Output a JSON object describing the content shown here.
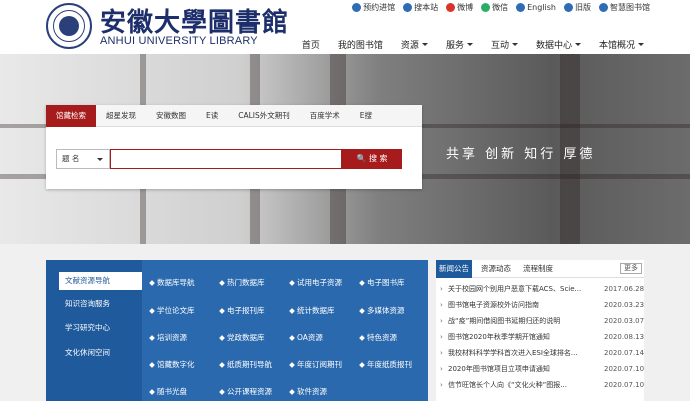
{
  "header": {
    "title_cn": "安徽大學圖書館",
    "title_en": "ANHUI UNIVERSITY LIBRARY",
    "quicklinks": [
      {
        "label": "预约进馆",
        "icon": "clock-icon",
        "color": "#2f6cb3"
      },
      {
        "label": "搜本站",
        "icon": "search-icon",
        "color": "#2f6cb3"
      },
      {
        "label": "微博",
        "icon": "weibo-icon",
        "color": "#d9342b"
      },
      {
        "label": "微信",
        "icon": "wechat-icon",
        "color": "#2aae67"
      },
      {
        "label": "English",
        "icon": "english-icon",
        "color": "#2f6cb3"
      },
      {
        "label": "旧版",
        "icon": "old-version-icon",
        "color": "#2f6cb3"
      },
      {
        "label": "智慧图书馆",
        "icon": "smart-library-icon",
        "color": "#2f6cb3"
      }
    ],
    "nav": [
      {
        "label": "首页",
        "dropdown": false
      },
      {
        "label": "我的图书馆",
        "dropdown": false
      },
      {
        "label": "资源",
        "dropdown": true
      },
      {
        "label": "服务",
        "dropdown": true
      },
      {
        "label": "互动",
        "dropdown": true
      },
      {
        "label": "数据中心",
        "dropdown": true
      },
      {
        "label": "本馆概况",
        "dropdown": true
      }
    ]
  },
  "banner": {
    "slogan": "共享 创新 知行 厚德"
  },
  "search": {
    "tabs": [
      "馆藏检索",
      "超星发现",
      "安徽数图",
      "E读",
      "CALIS外文期刊",
      "百度学术",
      "E搜"
    ],
    "active_tab": 0,
    "field_select": "题 名",
    "query": "",
    "button": "搜 索"
  },
  "services": {
    "items": [
      "文献资源导航",
      "知识咨询服务",
      "学习研究中心",
      "文化休闲空间"
    ],
    "active": 0
  },
  "resources": [
    [
      "数据库导航",
      "热门数据库",
      "试用电子资源",
      "电子图书库"
    ],
    [
      "学位论文库",
      "电子报刊库",
      "统计数据库",
      "多媒体资源"
    ],
    [
      "培训资源",
      "党政数据库",
      "OA资源",
      "特色资源"
    ],
    [
      "馆藏数字化",
      "纸质期刊导航",
      "年度订阅期刊",
      "年度纸质报刊"
    ],
    [
      "随书光盘",
      "公开课程资源",
      "软件资源",
      ""
    ]
  ],
  "news": {
    "tabs": [
      "新闻公告",
      "资源动态",
      "流程制度"
    ],
    "active": 0,
    "more": "更多",
    "items": [
      {
        "title": "关于校园网个别用户恶意下载ACS、Scie...",
        "date": "2017.06.28"
      },
      {
        "title": "图书馆电子资源校外访问指南",
        "date": "2020.03.23"
      },
      {
        "title": "战“疫”期间借阅图书延期归还的说明",
        "date": "2020.03.07"
      },
      {
        "title": "图书馆2020年秋季学期开馆通知",
        "date": "2020.08.13"
      },
      {
        "title": "我校材料科学学科首次进入ESI全球排名...",
        "date": "2020.07.14"
      },
      {
        "title": "2020年图书馆项目立项申请通知",
        "date": "2020.07.10"
      },
      {
        "title": "信节旺馆长个人向《“文化火种”图报...",
        "date": "2020.07.10"
      }
    ]
  }
}
